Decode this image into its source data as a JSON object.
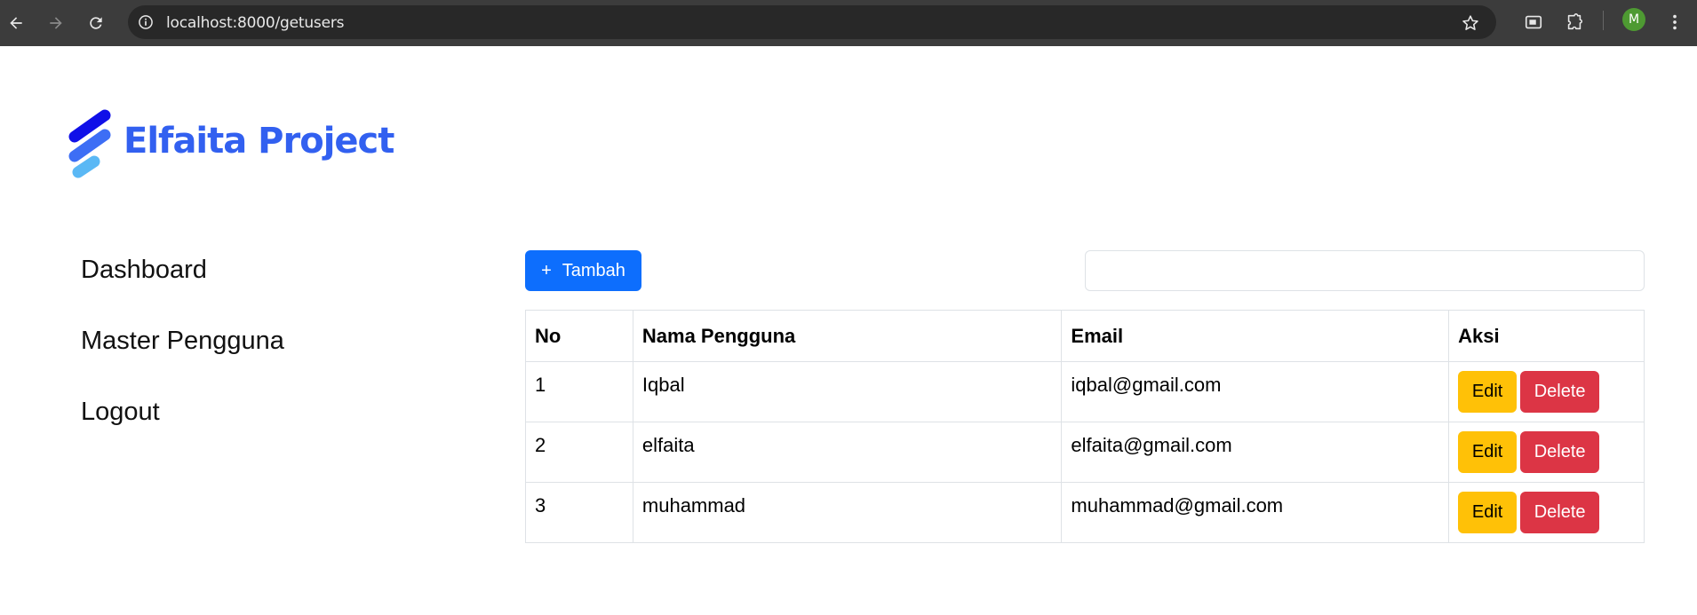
{
  "browser": {
    "url": "localhost:8000/getusers",
    "profile_initial": "M",
    "profile_color": "#4e9a32"
  },
  "brand": {
    "name": "Elfaita Project",
    "color": "#3260f0"
  },
  "sidebar": {
    "items": [
      {
        "label": "Dashboard"
      },
      {
        "label": "Master Pengguna"
      },
      {
        "label": "Logout"
      }
    ]
  },
  "toolbar": {
    "add_icon": "+",
    "add_label": "Tambah",
    "search_value": "",
    "search_placeholder": ""
  },
  "table": {
    "headers": [
      "No",
      "Nama Pengguna",
      "Email",
      "Aksi"
    ],
    "rows": [
      {
        "no": "1",
        "name": "Iqbal",
        "email": "iqbal@gmail.com"
      },
      {
        "no": "2",
        "name": "elfaita",
        "email": "elfaita@gmail.com"
      },
      {
        "no": "3",
        "name": "muhammad",
        "email": "muhammad@gmail.com"
      }
    ],
    "edit_label": "Edit",
    "delete_label": "Delete"
  },
  "colors": {
    "primary": "#0d6efd",
    "warning": "#ffc107",
    "danger": "#dc3545"
  }
}
